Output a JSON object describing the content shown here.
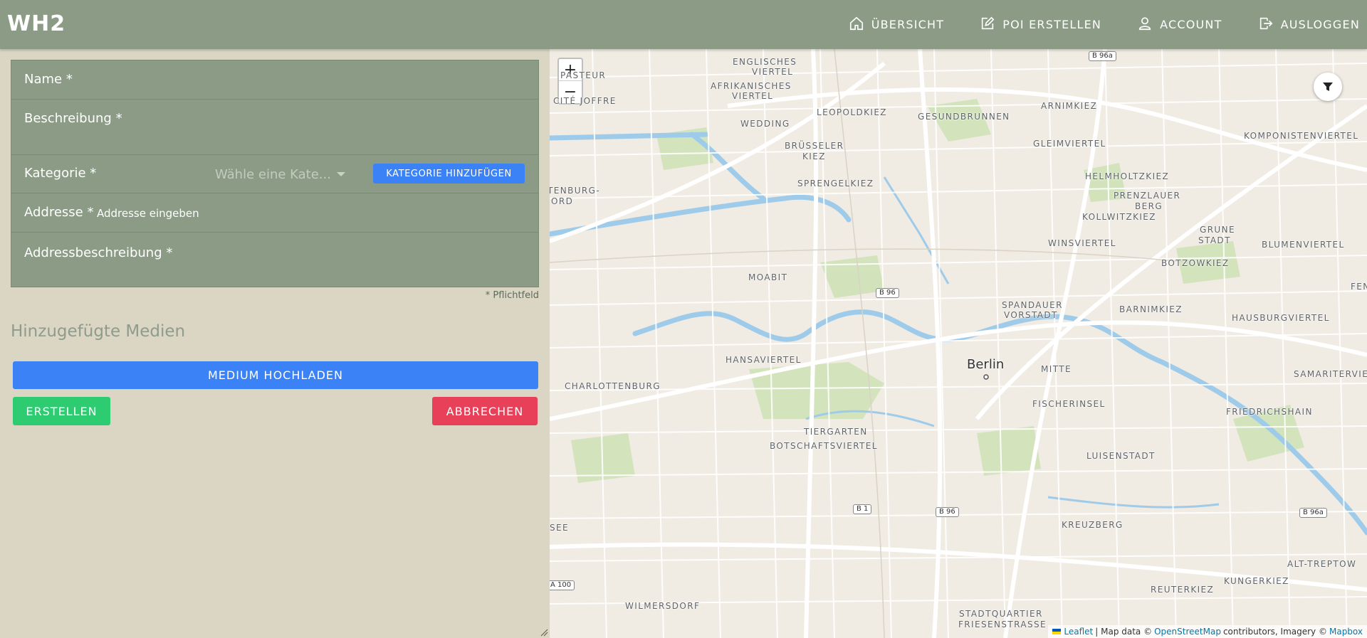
{
  "header": {
    "logo": "WH2",
    "nav": [
      {
        "label": "ÜBERSICHT",
        "icon": "home-icon"
      },
      {
        "label": "POI ERSTELLEN",
        "icon": "edit-icon"
      },
      {
        "label": "ACCOUNT",
        "icon": "user-icon"
      },
      {
        "label": "AUSLOGGEN",
        "icon": "logout-icon"
      }
    ]
  },
  "form": {
    "name_label": "Name *",
    "description_label": "Beschreibung *",
    "category_label": "Kategorie *",
    "category_placeholder": "Wähle eine Kate...",
    "add_category_label": "KATEGORIE HINZUFÜGEN",
    "address_label": "Addresse *",
    "address_placeholder": "Addresse eingeben",
    "address_description_label": "Addressbeschreibung *",
    "required_note": "* Pflichtfeld"
  },
  "media": {
    "title": "Hinzugefügte Medien",
    "upload_label": "MEDIUM HOCHLADEN"
  },
  "actions": {
    "create_label": "ERSTELLEN",
    "cancel_label": "ABBRECHEN"
  },
  "map": {
    "zoom_in": "+",
    "zoom_out": "−",
    "city": "Berlin",
    "districts": [
      "ENGLISCHES",
      "VIERTEL",
      "AFRIKANISCHES",
      "VIERTEL",
      "LEOPOLDKIEZ",
      "GESUNDBRUNNEN",
      "ARNIMKIEZ",
      "KOMPONISTENVIERTEL",
      "WEDDING",
      "BRÜSSELER",
      "KIEZ",
      "GLEIMVIERTEL",
      "SPRENGELKIEZ",
      "HELMHOLTZKIEZ",
      "PRENZLAUER",
      "BERG",
      "KOLLWITZKIEZ",
      "GRUNE",
      "STADT",
      "WINSVIERTEL",
      "BLUMENVIERTEL",
      "BOTZOWKIEZ",
      "MOABIT",
      "SPANDAUER",
      "VORSTADT",
      "BARNIMKIEZ",
      "HAUSBURGVIERTEL",
      "HANSAVIERTEL",
      "MITTE",
      "SAMARITERVIERTEL",
      "CHARLOTTENBURG",
      "FISCHERINSEL",
      "FRIEDRICHSHAIN",
      "TIERGARTEN",
      "BOTSCHAFTSVIERTEL",
      "LUISENSTADT",
      "KREUZBERG",
      "ALT-TREPTOW",
      "KUNGERKIEZ",
      "REUTERKIEZ",
      "WILMERSDORF",
      "STADTQUARTIER",
      "FRIESENSTRASSE",
      "CITÉ JOFFRE",
      "PASTEUR",
      "TENBURG-",
      "ORD",
      "SEE",
      "FEN"
    ],
    "roads": [
      "B 96a",
      "B 96",
      "B 1",
      "B 96",
      "B 96a",
      "A 100"
    ],
    "attribution": {
      "leaflet": "Leaflet",
      "map_data": "| Map data ©",
      "osm": "OpenStreetMap",
      "contributors": "contributors, Imagery ©",
      "mapbox": "Mapbox"
    }
  },
  "colors": {
    "header_bg": "#8b9b86",
    "panel_bg": "#dbd5c3",
    "primary": "#3b82f6",
    "success": "#2ecc71",
    "danger": "#e9405a"
  }
}
